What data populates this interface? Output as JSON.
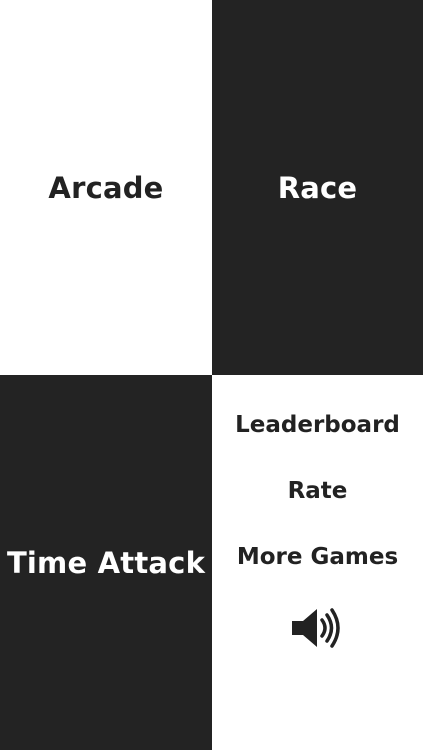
{
  "modes": {
    "arcade": "Arcade",
    "race": "Race",
    "time_attack": "Time Attack"
  },
  "menu": {
    "leaderboard": "Leaderboard",
    "rate": "Rate",
    "more_games": "More Games",
    "sound_icon": "speaker-volume-icon",
    "sound_on": true
  },
  "colors": {
    "dark_tile": "#232323",
    "light_tile": "#ffffff",
    "dark_text": "#222222",
    "light_text": "#ffffff"
  }
}
